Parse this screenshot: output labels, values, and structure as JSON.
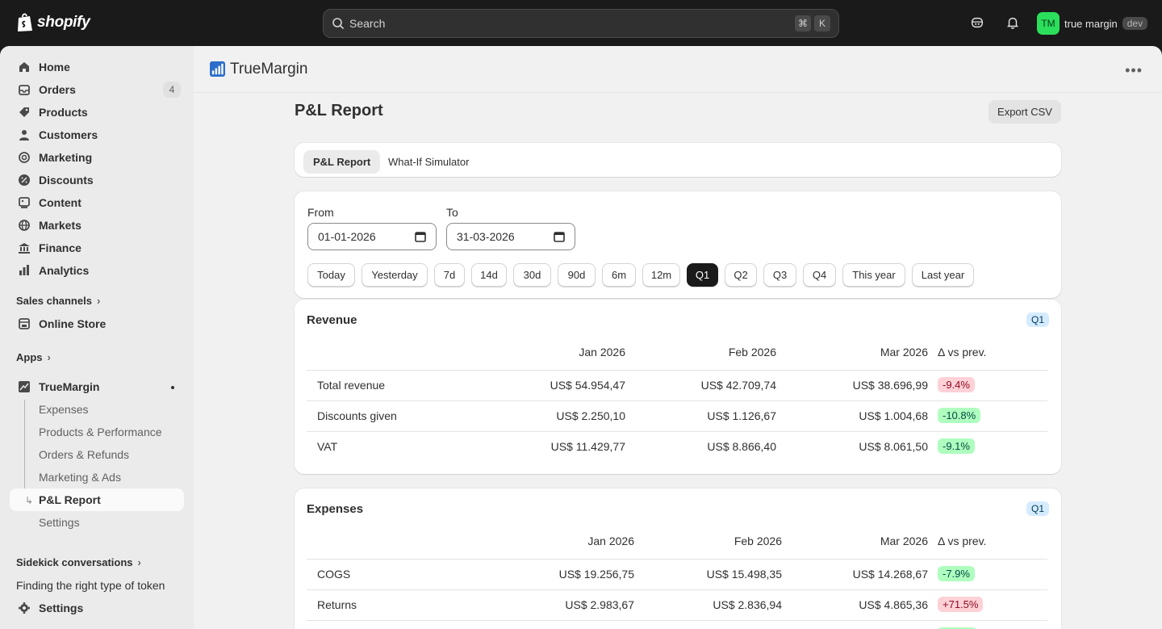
{
  "topbar": {
    "brand": "shopify",
    "search_placeholder": "Search",
    "kbd": [
      "⌘",
      "K"
    ],
    "user_initials": "TM",
    "user_name": "true margin",
    "user_badge": "dev"
  },
  "sidebar": {
    "items": [
      {
        "label": "Home",
        "icon": "home-icon"
      },
      {
        "label": "Orders",
        "icon": "orders-icon",
        "count": "4"
      },
      {
        "label": "Products",
        "icon": "tag-icon"
      },
      {
        "label": "Customers",
        "icon": "person-icon"
      },
      {
        "label": "Marketing",
        "icon": "target-icon"
      },
      {
        "label": "Discounts",
        "icon": "discount-icon"
      },
      {
        "label": "Content",
        "icon": "content-icon"
      },
      {
        "label": "Markets",
        "icon": "globe-icon"
      },
      {
        "label": "Finance",
        "icon": "bank-icon"
      },
      {
        "label": "Analytics",
        "icon": "chart-icon"
      }
    ],
    "sales_channels_label": "Sales channels",
    "online_store": "Online Store",
    "apps_label": "Apps",
    "app_name": "TrueMargin",
    "app_sub": [
      "Expenses",
      "Products & Performance",
      "Orders & Refunds",
      "Marketing & Ads",
      "P&L Report",
      "Settings"
    ],
    "sidekick_label": "Sidekick conversations",
    "sidekick_item": "Finding the right type of token",
    "settings": "Settings"
  },
  "appbar": {
    "name": "TrueMargin"
  },
  "page": {
    "title": "P&L Report",
    "export_label": "Export CSV"
  },
  "tabs": [
    "P&L Report",
    "What-If Simulator"
  ],
  "filters": {
    "from_label": "From",
    "from_value": "01-01-2026",
    "to_label": "To",
    "to_value": "31-03-2026",
    "presets": [
      "Today",
      "Yesterday",
      "7d",
      "14d",
      "30d",
      "90d",
      "6m",
      "12m",
      "Q1",
      "Q2",
      "Q3",
      "Q4",
      "This year",
      "Last year"
    ],
    "active_preset": "Q1"
  },
  "revenue": {
    "title": "Revenue",
    "badge": "Q1",
    "columns": [
      "Jan 2026",
      "Feb 2026",
      "Mar 2026",
      "Δ vs prev."
    ],
    "rows": [
      {
        "label": "Total revenue",
        "values": [
          "US$ 54.954,47",
          "US$ 42.709,74",
          "US$ 38.696,99"
        ],
        "delta": "-9.4%",
        "tone": "bad"
      },
      {
        "label": "Discounts given",
        "values": [
          "US$ 2.250,10",
          "US$ 1.126,67",
          "US$ 1.004,68"
        ],
        "delta": "-10.8%",
        "tone": "good"
      },
      {
        "label": "VAT",
        "values": [
          "US$ 11.429,77",
          "US$ 8.866,40",
          "US$ 8.061,50"
        ],
        "delta": "-9.1%",
        "tone": "good"
      }
    ]
  },
  "expenses": {
    "title": "Expenses",
    "badge": "Q1",
    "columns": [
      "Jan 2026",
      "Feb 2026",
      "Mar 2026",
      "Δ vs prev."
    ],
    "rows": [
      {
        "label": "COGS",
        "values": [
          "US$ 19.256,75",
          "US$ 15.498,35",
          "US$ 14.268,67"
        ],
        "delta": "-7.9%",
        "tone": "good"
      },
      {
        "label": "Returns",
        "values": [
          "US$ 2.983,67",
          "US$ 2.836,94",
          "US$ 4.865,36"
        ],
        "delta": "+71.5%",
        "tone": "bad"
      }
    ]
  },
  "colors": {
    "accent": "#1a1a1a",
    "badge_blue": "#d5ebff",
    "bad": "#fed1d7",
    "good": "#affebf",
    "brand_green": "#2bdf5c",
    "app_icon": "#2c6ecb"
  }
}
